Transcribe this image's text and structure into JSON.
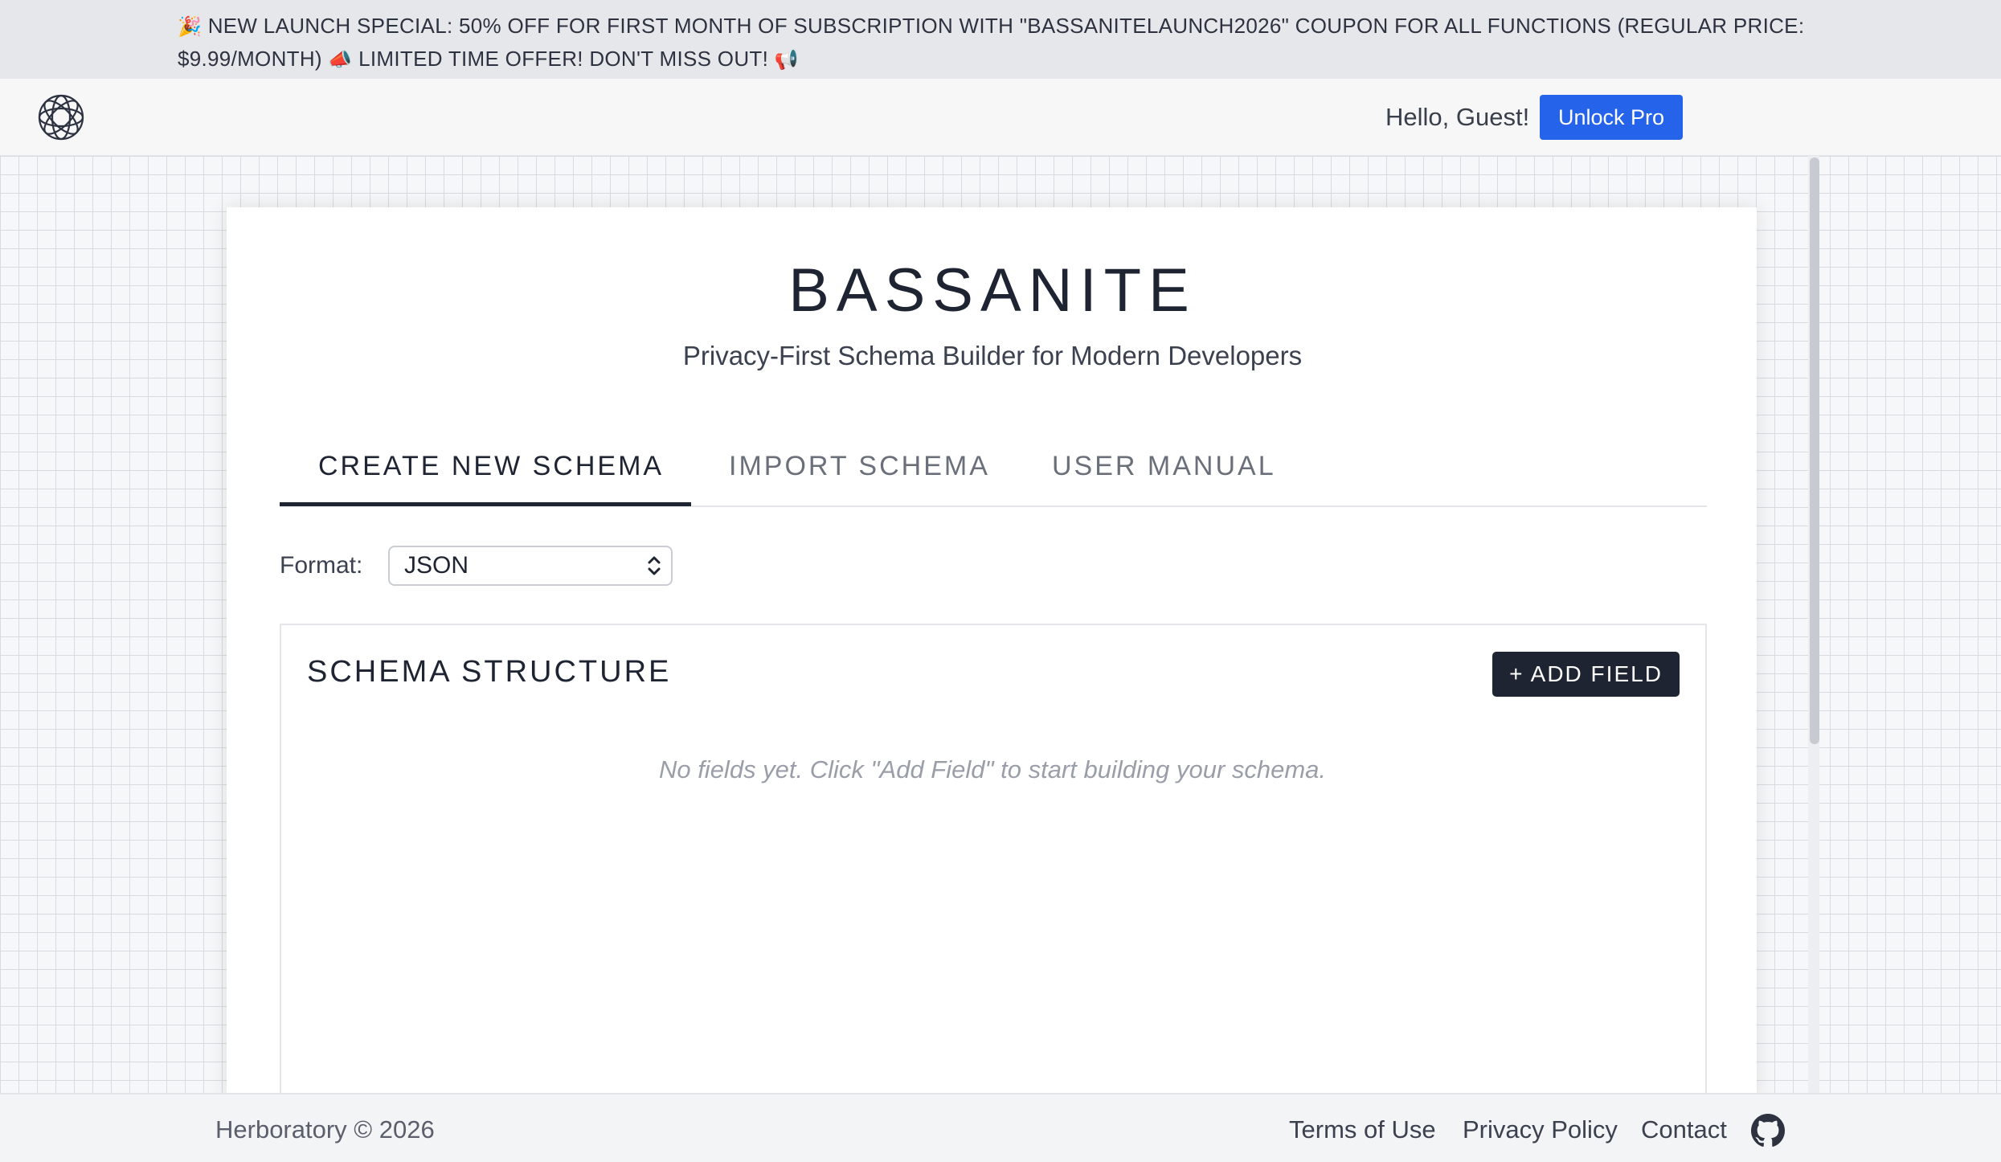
{
  "promo": {
    "party_emoji": "🎉",
    "text": "NEW LAUNCH SPECIAL: 50% OFF FOR FIRST MONTH OF SUBSCRIPTION WITH \"BASSANITELAUNCH2026\" COUPON FOR ALL FUNCTIONS   (REGULAR PRICE: $9.99/MONTH)",
    "megaphone_emoji": "📣",
    "text2": "LIMITED TIME OFFER! DON'T MISS OUT!",
    "loudspeaker_emoji": "📢"
  },
  "header": {
    "logo_icon": "orbit-logo-icon",
    "greeting": "Hello, Guest!",
    "unlock_label": "Unlock Pro"
  },
  "main": {
    "title": "BASSANITE",
    "subtitle": "Privacy-First Schema Builder for Modern Developers",
    "tabs": [
      {
        "label": "CREATE NEW SCHEMA",
        "active": true
      },
      {
        "label": "IMPORT SCHEMA",
        "active": false
      },
      {
        "label": "USER MANUAL",
        "active": false
      }
    ],
    "format": {
      "label": "Format:",
      "selected": "JSON"
    },
    "schema_panel": {
      "title": "SCHEMA STRUCTURE",
      "add_field_label": "+ ADD FIELD",
      "empty_message": "No fields yet. Click \"Add Field\" to start building your schema."
    }
  },
  "footer": {
    "copyright": "Herboratory © 2026",
    "links": [
      "Terms of Use",
      "Privacy Policy",
      "Contact"
    ],
    "github_icon": "github-icon"
  },
  "colors": {
    "accent": "#2563eb",
    "dark": "#1f2433",
    "banner_bg": "#e6e7ea"
  }
}
